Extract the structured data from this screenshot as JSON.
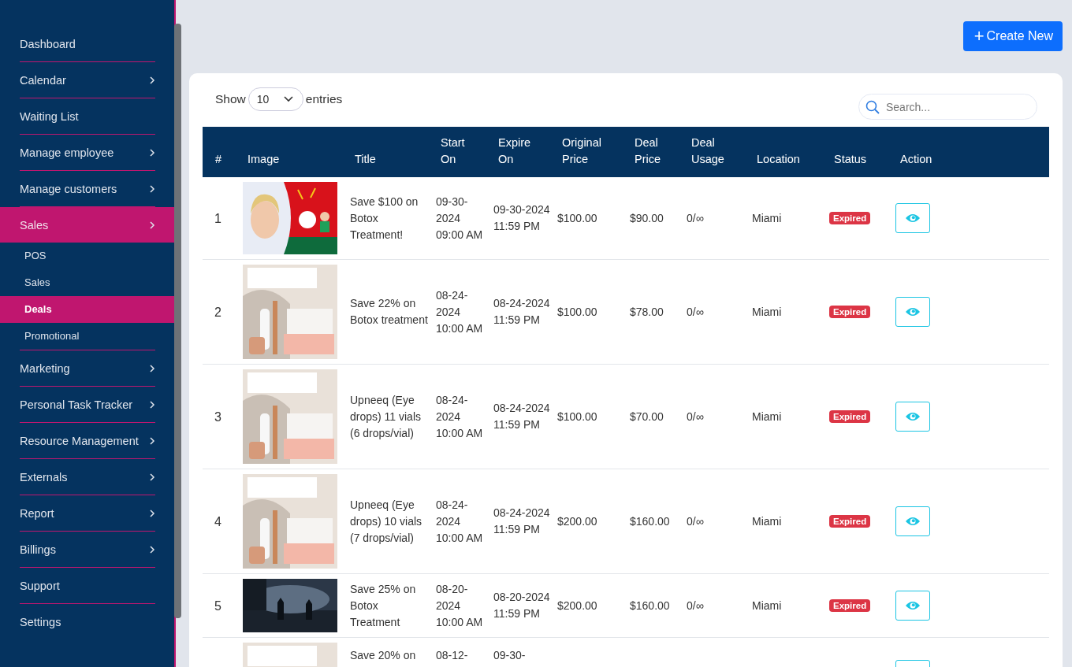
{
  "sidebar": {
    "items": [
      {
        "label": "Dashboard",
        "submenu": false,
        "selected": false
      },
      {
        "label": "Calendar",
        "submenu": true,
        "selected": false
      },
      {
        "label": "Waiting List",
        "submenu": false,
        "selected": false
      },
      {
        "label": "Manage employee",
        "submenu": true,
        "selected": false
      },
      {
        "label": "Manage customers",
        "submenu": true,
        "selected": false
      },
      {
        "label": "Sales",
        "submenu": true,
        "selected": true,
        "expanded": true,
        "children": [
          {
            "label": "POS",
            "selected": false
          },
          {
            "label": "Sales",
            "selected": false
          },
          {
            "label": "Deals",
            "selected": true
          },
          {
            "label": "Promotional",
            "selected": false
          }
        ]
      },
      {
        "label": "Marketing",
        "submenu": true,
        "selected": false
      },
      {
        "label": "Personal Task Tracker",
        "submenu": true,
        "selected": false
      },
      {
        "label": "Resource Management",
        "submenu": true,
        "selected": false
      },
      {
        "label": "Externals",
        "submenu": true,
        "selected": false
      },
      {
        "label": "Report",
        "submenu": true,
        "selected": false
      },
      {
        "label": "Billings",
        "submenu": true,
        "selected": false
      },
      {
        "label": "Support",
        "submenu": false,
        "selected": false
      },
      {
        "label": "Settings",
        "submenu": false,
        "selected": false
      }
    ]
  },
  "create_button": {
    "icon": "+",
    "label": "Create New"
  },
  "entries": {
    "before": "Show",
    "value": "10",
    "after": "entries"
  },
  "search": {
    "placeholder": "Search..."
  },
  "table": {
    "columns": [
      "#",
      "Image",
      "Title",
      "Start On",
      "Expire On",
      "Original Price",
      "Deal Price",
      "Deal Usage",
      "Location",
      "Status",
      "Action"
    ],
    "rows": [
      {
        "number": "1",
        "title": "Save $100 on Botox Treatment!",
        "start": "09-30-2024 09:00 AM",
        "expire": "09-30-2024 11:59 PM",
        "original_price": "$100.00",
        "deal_price": "$90.00",
        "usage": "0/∞",
        "location": "Miami",
        "status": "Expired"
      },
      {
        "number": "2",
        "title": "Save 22% on Botox treatment",
        "start": "08-24-2024 10:00 AM",
        "expire": "08-24-2024 11:59 PM",
        "original_price": "$100.00",
        "deal_price": "$78.00",
        "usage": "0/∞",
        "location": "Miami",
        "status": "Expired"
      },
      {
        "number": "3",
        "title": "Upneeq (Eye drops) 11 vials (6 drops/vial)",
        "start": "08-24-2024 10:00 AM",
        "expire": "08-24-2024 11:59 PM",
        "original_price": "$100.00",
        "deal_price": "$70.00",
        "usage": "0/∞",
        "location": "Miami",
        "status": "Expired"
      },
      {
        "number": "4",
        "title": "Upneeq (Eye drops) 10 vials (7 drops/vial)",
        "start": "08-24-2024 10:00 AM",
        "expire": "08-24-2024 11:59 PM",
        "original_price": "$200.00",
        "deal_price": "$160.00",
        "usage": "0/∞",
        "location": "Miami",
        "status": "Expired"
      },
      {
        "number": "5",
        "title": "Save 25% on Botox Treatment",
        "start": "08-20-2024 10:00 AM",
        "expire": "08-20-2024 11:59 PM",
        "original_price": "$200.00",
        "deal_price": "$160.00",
        "usage": "0/∞",
        "location": "Miami",
        "status": "Expired"
      },
      {
        "title": "Save 20% on",
        "start": "08-12-",
        "expire": "09-30-"
      }
    ]
  }
}
